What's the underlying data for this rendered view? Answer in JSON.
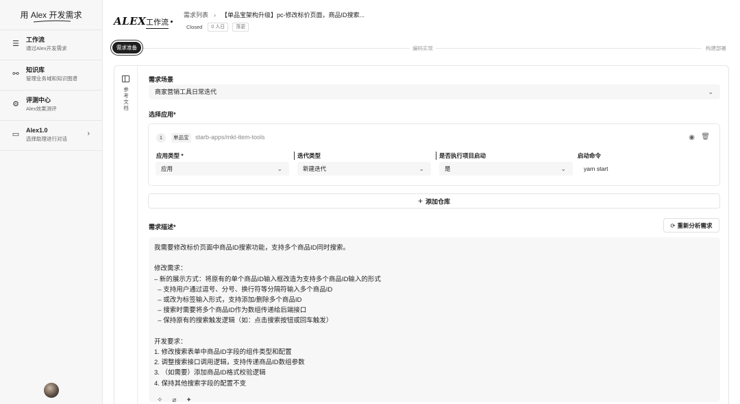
{
  "sidebar": {
    "title": "用 Alex 开发需求",
    "items": [
      {
        "label": "工作流",
        "desc": "通过Alex开发需求",
        "icon": "workflow-icon"
      },
      {
        "label": "知识库",
        "desc": "管理业务域和知识图谱",
        "icon": "knowledge-graph-icon"
      },
      {
        "label": "评测中心",
        "desc": "Alex效果测评",
        "icon": "gear-icon"
      },
      {
        "label": "Alex1.0",
        "desc": "选择助理进行对话",
        "icon": "chat-icon"
      }
    ]
  },
  "header": {
    "logo": "ALEX",
    "logo_sub": "工作流",
    "breadcrumb_root": "需求列表",
    "breadcrumb_current": "【单品宝架构升级】pc-修改标价页面，商品ID搜索...",
    "status": "Closed",
    "people": "0 人日",
    "tag": "落更"
  },
  "steps": {
    "active": "需求准备",
    "second": "编码实现",
    "third": "构建部署"
  },
  "reference": {
    "label": "参考文档"
  },
  "scene": {
    "label": "需求场景",
    "value": "商家营销工具日常迭代"
  },
  "apps": {
    "label": "选择应用*",
    "index": "1",
    "repo_tag": "单品宝",
    "repo_path": "starb-apps/mkt-item-tools",
    "fields": {
      "type_label": "应用类型 *",
      "type_value": "应用",
      "iter_label": "迭代类型",
      "iter_value": "新建迭代",
      "exec_label": "是否执行项目启动",
      "exec_value": "是",
      "cmd_label": "启动命令",
      "cmd_value": "yarn start"
    },
    "add_repo": "添加仓库"
  },
  "description": {
    "label": "需求描述*",
    "reanalyze": "重新分析需求",
    "lines": [
      "我需要修改标价页面中商品ID搜索功能，支持多个商品ID同时搜索。",
      "",
      "修改需求：",
      "– 新的展示方式：将原有的单个商品ID输入框改造为支持多个商品ID输入的形式",
      "  – 支持用户通过逗号、分号、换行符等分隔符输入多个商品ID",
      "  – 或改为标签输入形式，支持添加/删除多个商品ID",
      "  – 搜索时需要将多个商品ID作为数组传递给后端接口",
      "  – 保持原有的搜索触发逻辑（如：点击搜索按钮或回车触发）",
      "",
      "开发要求：",
      "1. 修改搜索表单中商品ID字段的组件类型和配置",
      "2. 调整搜索接口调用逻辑，支持传递商品ID数组参数",
      "3. （如需要）添加商品ID格式校验逻辑",
      "4. 保持其他搜索字段的配置不变"
    ]
  }
}
